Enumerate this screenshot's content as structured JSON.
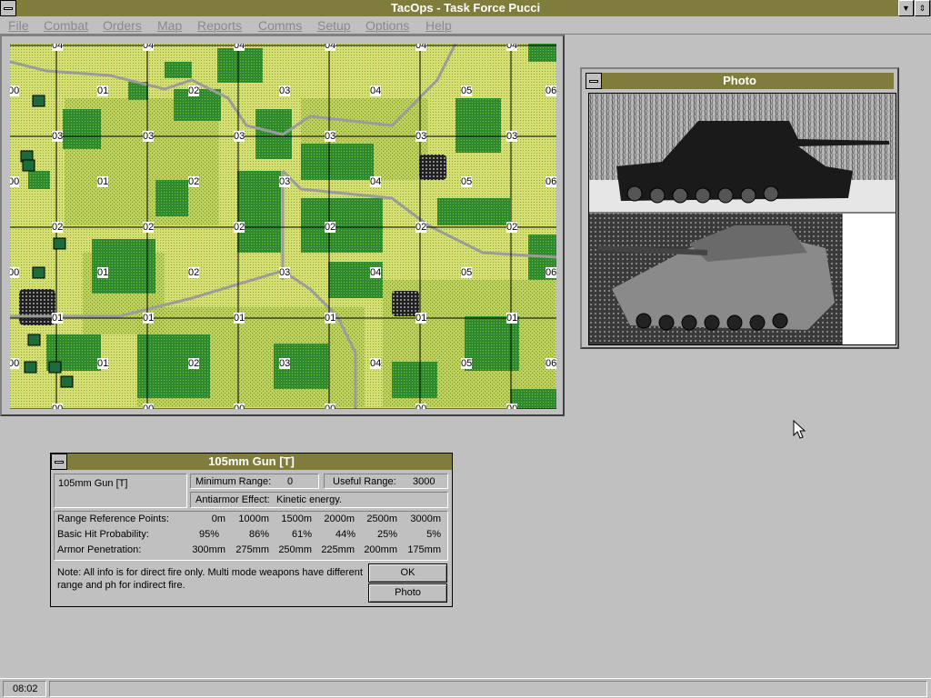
{
  "app": {
    "title": "TacOps - Task Force Pucci"
  },
  "menu": [
    "File",
    "Combat",
    "Orders",
    "Map",
    "Reports",
    "Comms",
    "Setup",
    "Options",
    "Help"
  ],
  "map": {
    "top_labels": [
      "04",
      "04",
      "04",
      "04",
      "04",
      "04"
    ],
    "bottom_labels": [
      "00",
      "00",
      "00",
      "00",
      "00",
      "00"
    ],
    "left_labels": [
      "00",
      "03",
      "00",
      "02",
      "00",
      "01",
      "00"
    ],
    "right_labels": [
      "06",
      "03",
      "06",
      "02",
      "06",
      "01",
      "06"
    ],
    "inner_row_04": [
      "01",
      "02",
      "03",
      "04",
      "05"
    ],
    "inner_row_03": [
      "03",
      "03",
      "03",
      "03"
    ],
    "inner_row_mid": [
      "01",
      "02",
      "03",
      "04",
      "05"
    ],
    "inner_row_02": [
      "02",
      "02",
      "02",
      "02"
    ],
    "inner_row_lower": [
      "01",
      "02",
      "03",
      "04",
      "05"
    ],
    "inner_row_01": [
      "01",
      "01",
      "01",
      "01",
      "01"
    ],
    "inner_row_bottom": [
      "01",
      "02",
      "03",
      "04",
      "05"
    ]
  },
  "photo_window": {
    "title": "Photo"
  },
  "weapon_dialog": {
    "title": "105mm Gun [T]",
    "name": "105mm Gun [T]",
    "min_range_label": "Minimum Range:",
    "min_range_value": "0",
    "useful_range_label": "Useful Range:",
    "useful_range_value": "3000",
    "antiarmor_label": "Antiarmor Effect:",
    "antiarmor_value": "Kinetic energy.",
    "rows": [
      {
        "label": "Range Reference Points:",
        "values": [
          "0m",
          "1000m",
          "1500m",
          "2000m",
          "2500m",
          "3000m"
        ]
      },
      {
        "label": "Basic Hit Probability:",
        "values": [
          "95%",
          "86%",
          "61%",
          "44%",
          "25%",
          "5%"
        ]
      },
      {
        "label": "Armor Penetration:",
        "values": [
          "300mm",
          "275mm",
          "250mm",
          "225mm",
          "200mm",
          "175mm"
        ]
      }
    ],
    "note_line1": "Note: All info is for direct fire only. Multi mode weapons have different",
    "note_line2": "range and ph for indirect fire.",
    "ok_label": "OK",
    "photo_label": "Photo"
  },
  "status": {
    "clock": "08:02"
  }
}
